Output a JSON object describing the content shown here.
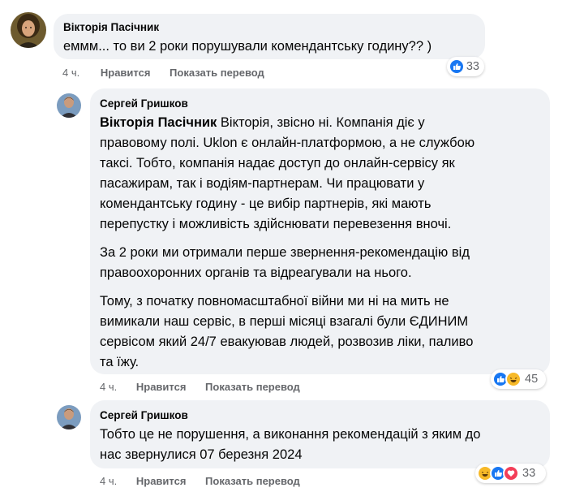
{
  "comment1": {
    "author": "Вікторія Пасічник",
    "text": "еммм... то ви 2 роки порушували комендантську годину?? )",
    "time": "4 ч.",
    "like_label": "Нравится",
    "translate_label": "Показать перевод",
    "reactions": [
      "like-icon"
    ],
    "reaction_count": "33"
  },
  "reply1": {
    "author": "Сергей Гришков",
    "mention": "Вікторія Пасічник",
    "line1_rest": " Вікторія, звісно ні. Компанія діє у",
    "lines": [
      "правовому полі. Uklon є онлайн-платформою, а не службою",
      "таксі. Тобто, компанія надає доступ до онлайн-сервісу як",
      "пасажирам, так і водіям-партнерам. Чи працювати у",
      "комендантську годину - це вибір партнерів, які мають",
      "перепустку і можливість здійснювати перевезення вночі."
    ],
    "para2": [
      "За 2 роки ми отримали перше звернення-рекомендацію від",
      "правоохоронних органів та відреагували на нього."
    ],
    "para3": [
      "Тому, з початку повномасштабної війни ми ні на мить не",
      "вимикали наш сервіс, в перші місяці взагалі були ЄДИНИМ",
      "сервісом який 24/7 евакуював людей, розвозив ліки, паливо",
      "та їжу."
    ],
    "time": "4 ч.",
    "like_label": "Нравится",
    "translate_label": "Показать перевод",
    "reactions": [
      "like-icon",
      "haha-icon"
    ],
    "reaction_count": "45"
  },
  "reply2": {
    "author": "Сергей Гришков",
    "lines": [
      "Тобто це не порушення, а виконання рекомендацій з яким до",
      "нас звернулися 07 березня 2024"
    ],
    "time": "4 ч.",
    "like_label": "Нравится",
    "translate_label": "Показать перевод",
    "reactions": [
      "haha-icon",
      "like-icon",
      "love-icon"
    ],
    "reaction_count": "33"
  },
  "colors": {
    "bubble": "#f0f2f5",
    "text": "#050505",
    "meta": "#65676b",
    "like": "#1877f2",
    "haha": "#f7b928",
    "love": "#f33e58"
  }
}
